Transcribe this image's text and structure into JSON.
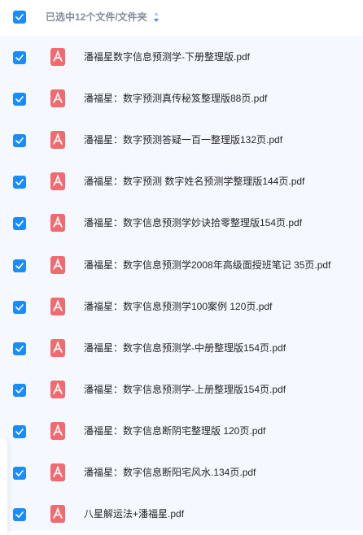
{
  "header": {
    "selection_label": "已选中12个文件/文件夹",
    "all_selected": true
  },
  "colors": {
    "checkbox": "#1a8cff",
    "pdf_icon": "#f06a6f",
    "list_bg": "#f5f9ff"
  },
  "files": [
    {
      "name": "潘福星数字信息预测学-下册整理版.pdf",
      "icon": "pdf-icon",
      "checked": true
    },
    {
      "name": "潘福星：数字预测真传秘笈整理版88页.pdf",
      "icon": "pdf-icon",
      "checked": true
    },
    {
      "name": "潘福星：数字预测答疑一百一整理版132页.pdf",
      "icon": "pdf-icon",
      "checked": true
    },
    {
      "name": "潘福星：数字预测 数字姓名预测学整理版144页.pdf",
      "icon": "pdf-icon",
      "checked": true
    },
    {
      "name": "潘福星：数字信息预测学妙诀拾零整理版154页.pdf",
      "icon": "pdf-icon",
      "checked": true
    },
    {
      "name": "潘福星：数字信息预测学2008年高级面授班笔记 35页.pdf",
      "icon": "pdf-icon",
      "checked": true
    },
    {
      "name": "潘福星：数字信息预测学100案例 120页.pdf",
      "icon": "pdf-icon",
      "checked": true
    },
    {
      "name": "潘福星：数字信息预测学-中册整理版154页.pdf",
      "icon": "pdf-icon",
      "checked": true
    },
    {
      "name": "潘福星：数字信息预测学-上册整理版154页.pdf",
      "icon": "pdf-icon",
      "checked": true
    },
    {
      "name": "潘福星：数字信息断阴宅整理版 120页.pdf",
      "icon": "pdf-icon",
      "checked": true
    },
    {
      "name": "潘福星：数字信息断阳宅风水.134页.pdf",
      "icon": "pdf-icon",
      "checked": true
    },
    {
      "name": "八星解运法+潘福星.pdf",
      "icon": "pdf-icon",
      "checked": true
    }
  ]
}
